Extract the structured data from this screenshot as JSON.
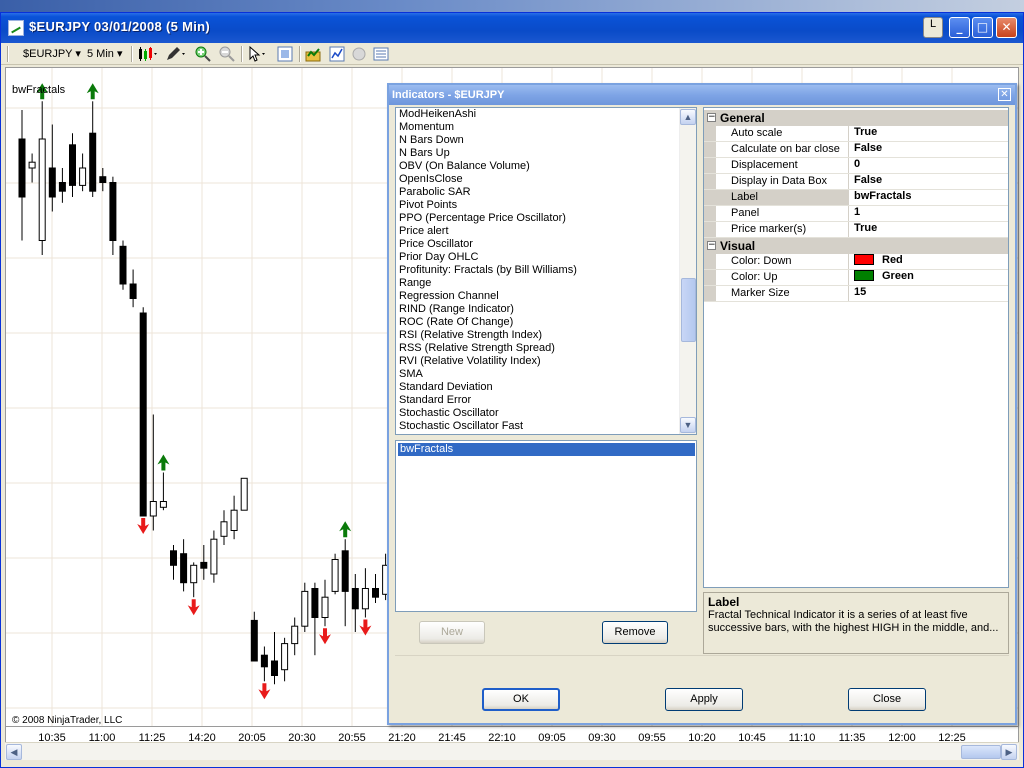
{
  "window": {
    "title": "$EURJPY  03/01/2008  (5 Min)",
    "button_l": "L",
    "min": "_",
    "max": "□",
    "close": "✕"
  },
  "toolbar": {
    "instrument": "$EURJPY",
    "interval": "5 Min",
    "dropdown": "▾"
  },
  "chart": {
    "indicator_label": "bwFractals",
    "copyright": "© 2008 NinjaTrader, LLC",
    "x_ticks": [
      "10:35",
      "11:00",
      "11:25",
      "14:20",
      "20:05",
      "20:30",
      "20:55",
      "21:20",
      "21:45",
      "22:10",
      "09:05",
      "09:30",
      "09:55",
      "10:20",
      "10:45",
      "11:10",
      "11:35",
      "12:00",
      "12:25"
    ],
    "colors": {
      "up_arrow": "#0a7a0a",
      "down_arrow": "#e81a1a",
      "grid": "#eee4d8"
    }
  },
  "chart_data": {
    "type": "candlestick",
    "candles": [
      {
        "o": 40,
        "c": 60,
        "h": 30,
        "l": 75
      },
      {
        "o": 50,
        "c": 48,
        "h": 45,
        "l": 55
      },
      {
        "o": 75,
        "c": 40,
        "h": 27,
        "l": 80
      },
      {
        "o": 50,
        "c": 60,
        "h": 35,
        "l": 65
      },
      {
        "o": 55,
        "c": 58,
        "h": 50,
        "l": 62
      },
      {
        "o": 42,
        "c": 56,
        "h": 38,
        "l": 60
      },
      {
        "o": 56,
        "c": 50,
        "h": 45,
        "l": 58
      },
      {
        "o": 38,
        "c": 58,
        "h": 27,
        "l": 60
      },
      {
        "o": 53,
        "c": 55,
        "h": 50,
        "l": 58
      },
      {
        "o": 55,
        "c": 75,
        "h": 53,
        "l": 80
      },
      {
        "o": 77,
        "c": 90,
        "h": 75,
        "l": 92
      },
      {
        "o": 90,
        "c": 95,
        "h": 85,
        "l": 98
      },
      {
        "o": 100,
        "c": 170,
        "h": 98,
        "l": 170
      },
      {
        "o": 170,
        "c": 165,
        "h": 135,
        "l": 175
      },
      {
        "o": 167,
        "c": 165,
        "h": 155,
        "l": 168
      },
      {
        "o": 182,
        "c": 187,
        "h": 180,
        "l": 192
      },
      {
        "o": 183,
        "c": 193,
        "h": 178,
        "l": 196
      },
      {
        "o": 193,
        "c": 187,
        "h": 186,
        "l": 198
      },
      {
        "o": 186,
        "c": 188,
        "h": 180,
        "l": 192
      },
      {
        "o": 190,
        "c": 178,
        "h": 175,
        "l": 193
      },
      {
        "o": 177,
        "c": 172,
        "h": 168,
        "l": 180
      },
      {
        "o": 175,
        "c": 168,
        "h": 163,
        "l": 178
      },
      {
        "o": 168,
        "c": 157,
        "h": 157,
        "l": 167
      },
      {
        "o": 206,
        "c": 220,
        "h": 203,
        "l": 220
      },
      {
        "o": 218,
        "c": 222,
        "h": 215,
        "l": 227
      },
      {
        "o": 220,
        "c": 225,
        "h": 210,
        "l": 228
      },
      {
        "o": 223,
        "c": 214,
        "h": 212,
        "l": 227
      },
      {
        "o": 214,
        "c": 208,
        "h": 205,
        "l": 218
      },
      {
        "o": 208,
        "c": 196,
        "h": 193,
        "l": 210
      },
      {
        "o": 195,
        "c": 205,
        "h": 193,
        "l": 218
      },
      {
        "o": 205,
        "c": 198,
        "h": 192,
        "l": 208
      },
      {
        "o": 196,
        "c": 185,
        "h": 183,
        "l": 197
      },
      {
        "o": 182,
        "c": 196,
        "h": 178,
        "l": 208
      },
      {
        "o": 195,
        "c": 202,
        "h": 190,
        "l": 210
      },
      {
        "o": 202,
        "c": 195,
        "h": 188,
        "l": 205
      },
      {
        "o": 195,
        "c": 198,
        "h": 190,
        "l": 200
      },
      {
        "o": 197,
        "c": 187,
        "h": 183,
        "l": 199
      }
    ],
    "up_fractals": [
      2,
      7,
      14,
      32
    ],
    "down_fractals": [
      12,
      17,
      24,
      30,
      34
    ]
  },
  "dialog": {
    "title": "Indicators - $EURJPY",
    "close": "✕",
    "indicators": [
      "ModHeikenAshi",
      "Momentum",
      "N Bars Down",
      "N Bars Up",
      "OBV (On Balance Volume)",
      "OpenIsClose",
      "Parabolic SAR",
      "Pivot Points",
      "PPO (Percentage Price Oscillator)",
      "Price alert",
      "Price Oscillator",
      "Prior Day OHLC",
      "Profitunity: Fractals (by Bill Williams)",
      "Range",
      "Regression Channel",
      "RIND (Range Indicator)",
      "ROC (Rate Of Change)",
      "RSI (Relative Strength Index)",
      "RSS (Relative Strength Spread)",
      "RVI (Relative Volatility Index)",
      "SMA",
      "Standard Deviation",
      "Standard Error",
      "Stochastic Oscillator",
      "Stochastic Oscillator Fast"
    ],
    "selected": [
      "bwFractals"
    ],
    "new_label": "New",
    "remove_label": "Remove",
    "ok_label": "OK",
    "apply_label": "Apply",
    "close_label": "Close",
    "general": {
      "title": "General",
      "expander": "−",
      "props": [
        {
          "name": "Auto scale",
          "value": "True"
        },
        {
          "name": "Calculate on bar close",
          "value": "False"
        },
        {
          "name": "Displacement",
          "value": "0"
        },
        {
          "name": "Display in Data Box",
          "value": "False"
        },
        {
          "name": "Label",
          "value": "bwFractals"
        },
        {
          "name": "Panel",
          "value": "1"
        },
        {
          "name": "Price marker(s)",
          "value": "True"
        }
      ]
    },
    "visual": {
      "title": "Visual",
      "expander": "−",
      "color_down_name": "Color: Down",
      "color_down_value": "Red",
      "color_down_hex": "#ff0000",
      "color_up_name": "Color: Up",
      "color_up_value": "Green",
      "color_up_hex": "#008000",
      "marker_name": "Marker Size",
      "marker_value": "15"
    },
    "desc_title": "Label",
    "desc_text": "Fractal Technical Indicator it is a series of at least five successive bars, with the highest HIGH in the middle, and..."
  }
}
